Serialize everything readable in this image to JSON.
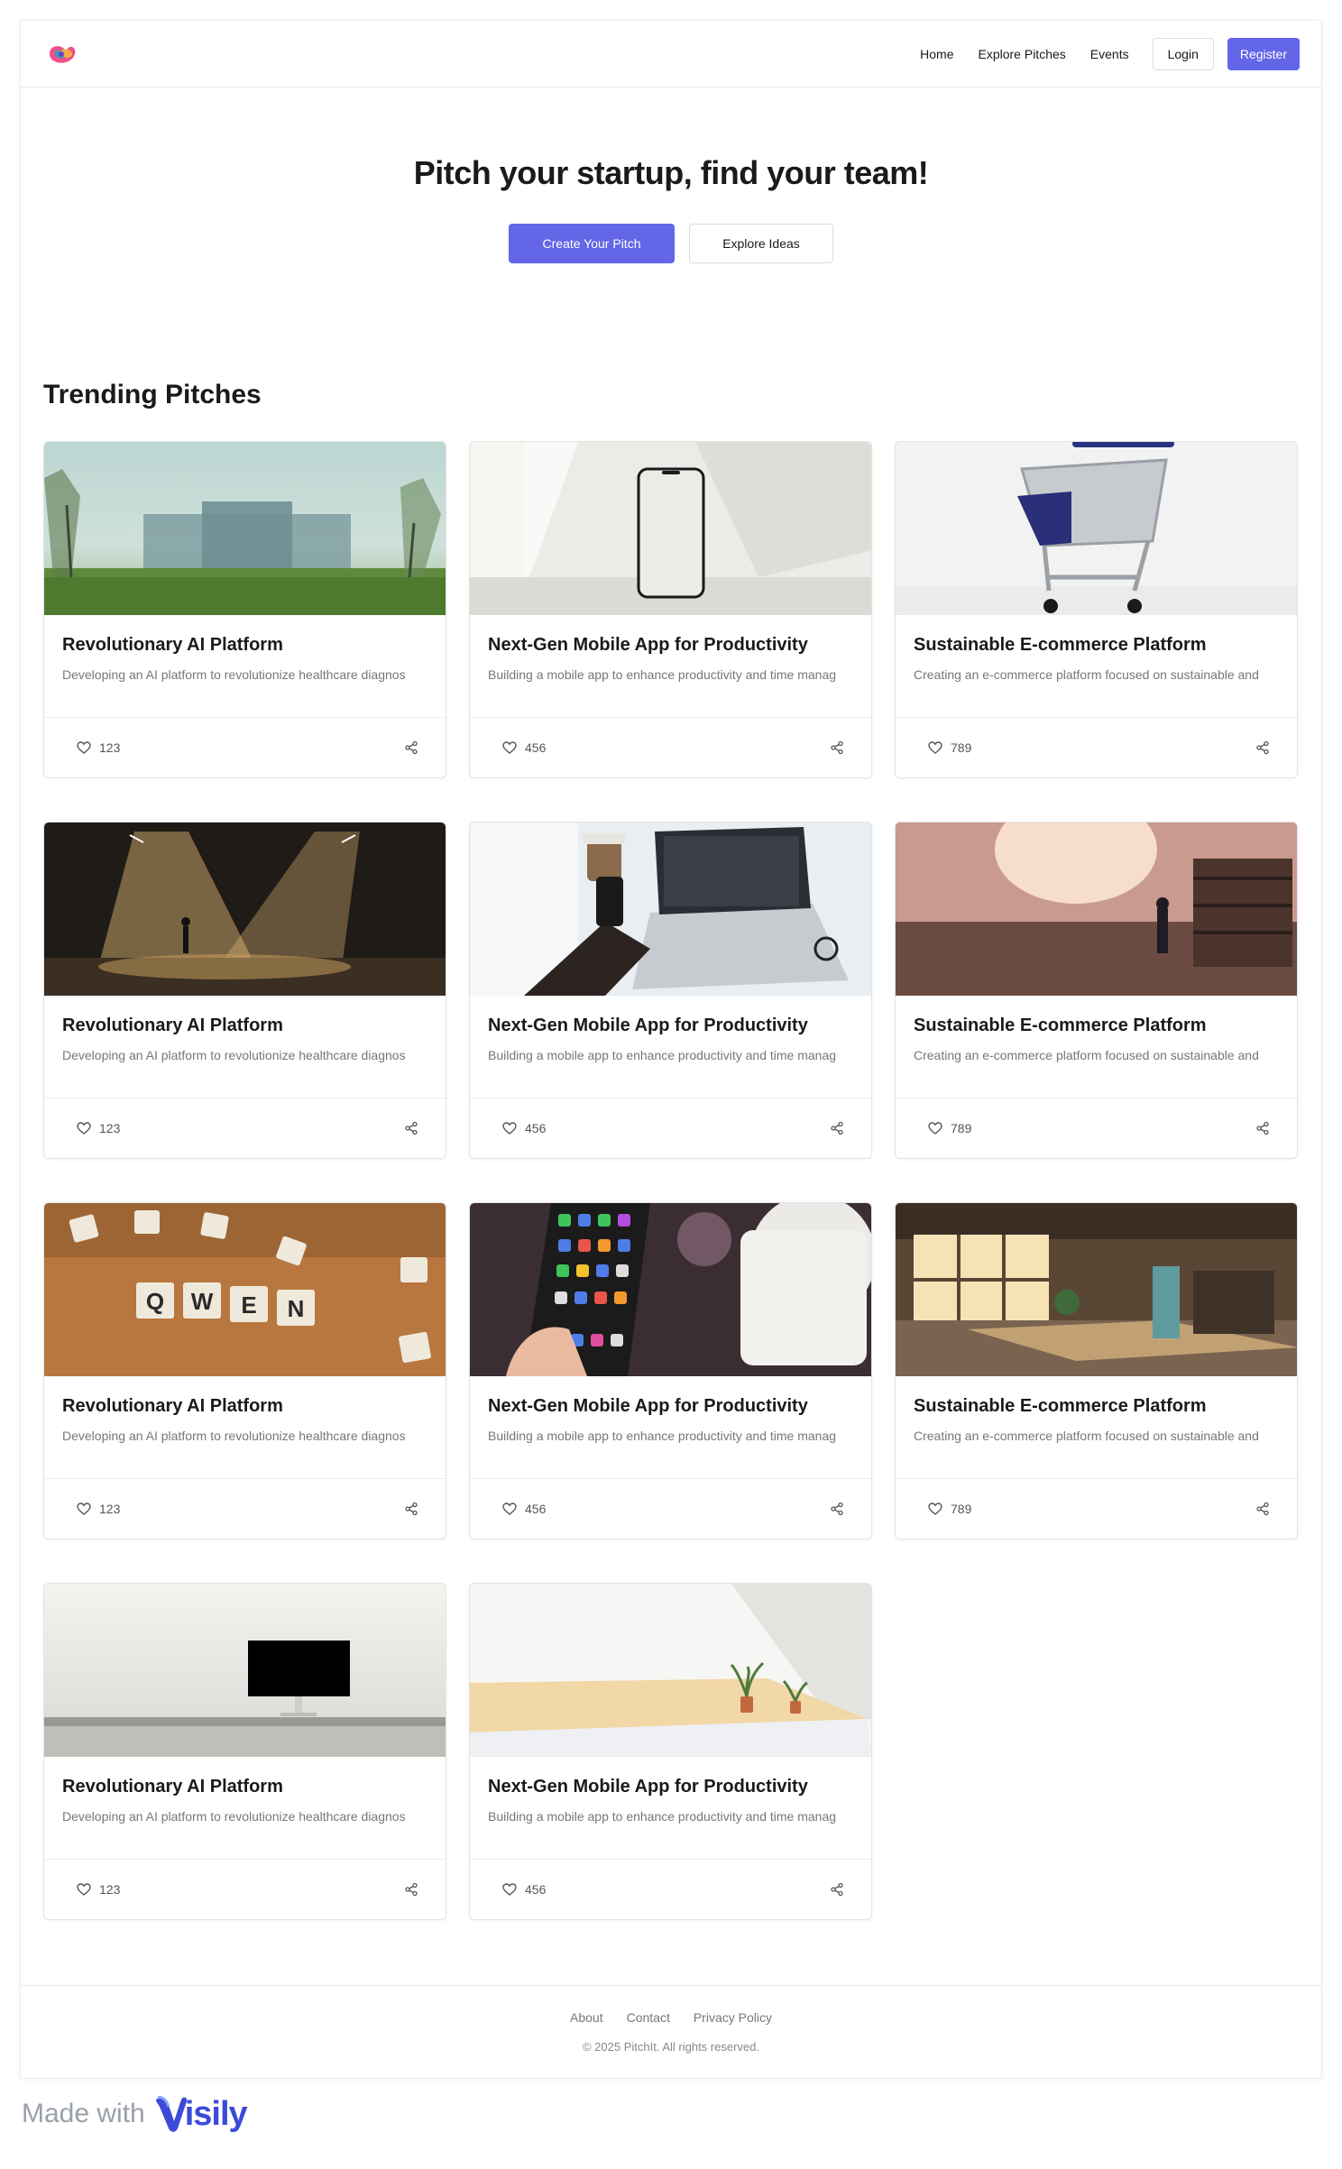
{
  "header": {
    "nav": [
      "Home",
      "Explore Pitches",
      "Events"
    ],
    "login_label": "Login",
    "register_label": "Register"
  },
  "hero": {
    "title": "Pitch your startup, find your team!",
    "primary_label": "Create Your Pitch",
    "secondary_label": "Explore Ideas"
  },
  "trending": {
    "title": "Trending Pitches",
    "cards": [
      {
        "title": "Revolutionary AI Platform",
        "desc": "Developing an AI platform to revolutionize healthcare diagnos",
        "likes": "123",
        "image": "misty-campus-building"
      },
      {
        "title": "Next-Gen Mobile App for Productivity",
        "desc": "Building a mobile app to enhance productivity and time manag",
        "likes": "456",
        "image": "phone-on-windowsill"
      },
      {
        "title": "Sustainable E-commerce Platform",
        "desc": "Creating an e-commerce platform focused on sustainable and",
        "likes": "789",
        "image": "shopping-cart"
      },
      {
        "title": "Revolutionary AI Platform",
        "desc": "Developing an AI platform to revolutionize healthcare diagnos",
        "likes": "123",
        "image": "stage-spotlights"
      },
      {
        "title": "Next-Gen Mobile App for Productivity",
        "desc": "Building a mobile app to enhance productivity and time manag",
        "likes": "456",
        "image": "laptop-and-phone"
      },
      {
        "title": "Sustainable E-commerce Platform",
        "desc": "Creating an e-commerce platform focused on sustainable and",
        "likes": "789",
        "image": "sunlit-store"
      },
      {
        "title": "Revolutionary AI Platform",
        "desc": "Developing an AI platform to revolutionize healthcare diagnos",
        "likes": "123",
        "image": "qwen-letter-tiles"
      },
      {
        "title": "Next-Gen Mobile App for Productivity",
        "desc": "Building a mobile app to enhance productivity and time manag",
        "likes": "456",
        "image": "phone-in-hand"
      },
      {
        "title": "Sustainable E-commerce Platform",
        "desc": "Creating an e-commerce platform focused on sustainable and",
        "likes": "789",
        "image": "sunny-office"
      },
      {
        "title": "Revolutionary AI Platform",
        "desc": "Developing an AI platform to revolutionize healthcare diagnos",
        "likes": "123",
        "image": "monitor-on-desk"
      },
      {
        "title": "Next-Gen Mobile App for Productivity",
        "desc": "Building a mobile app to enhance productivity and time manag",
        "likes": "456",
        "image": "plants-on-shelf"
      }
    ],
    "qwen_letters": [
      "Q",
      "W",
      "E",
      "N"
    ]
  },
  "footer": {
    "links": [
      "About",
      "Contact",
      "Privacy Policy"
    ],
    "copyright": "© 2025 PitchIt. All rights reserved."
  },
  "badge": {
    "made_with": "Made with",
    "brand": "isily"
  },
  "colors": {
    "accent": "#6366e6",
    "brand": "#3b4ad8"
  }
}
